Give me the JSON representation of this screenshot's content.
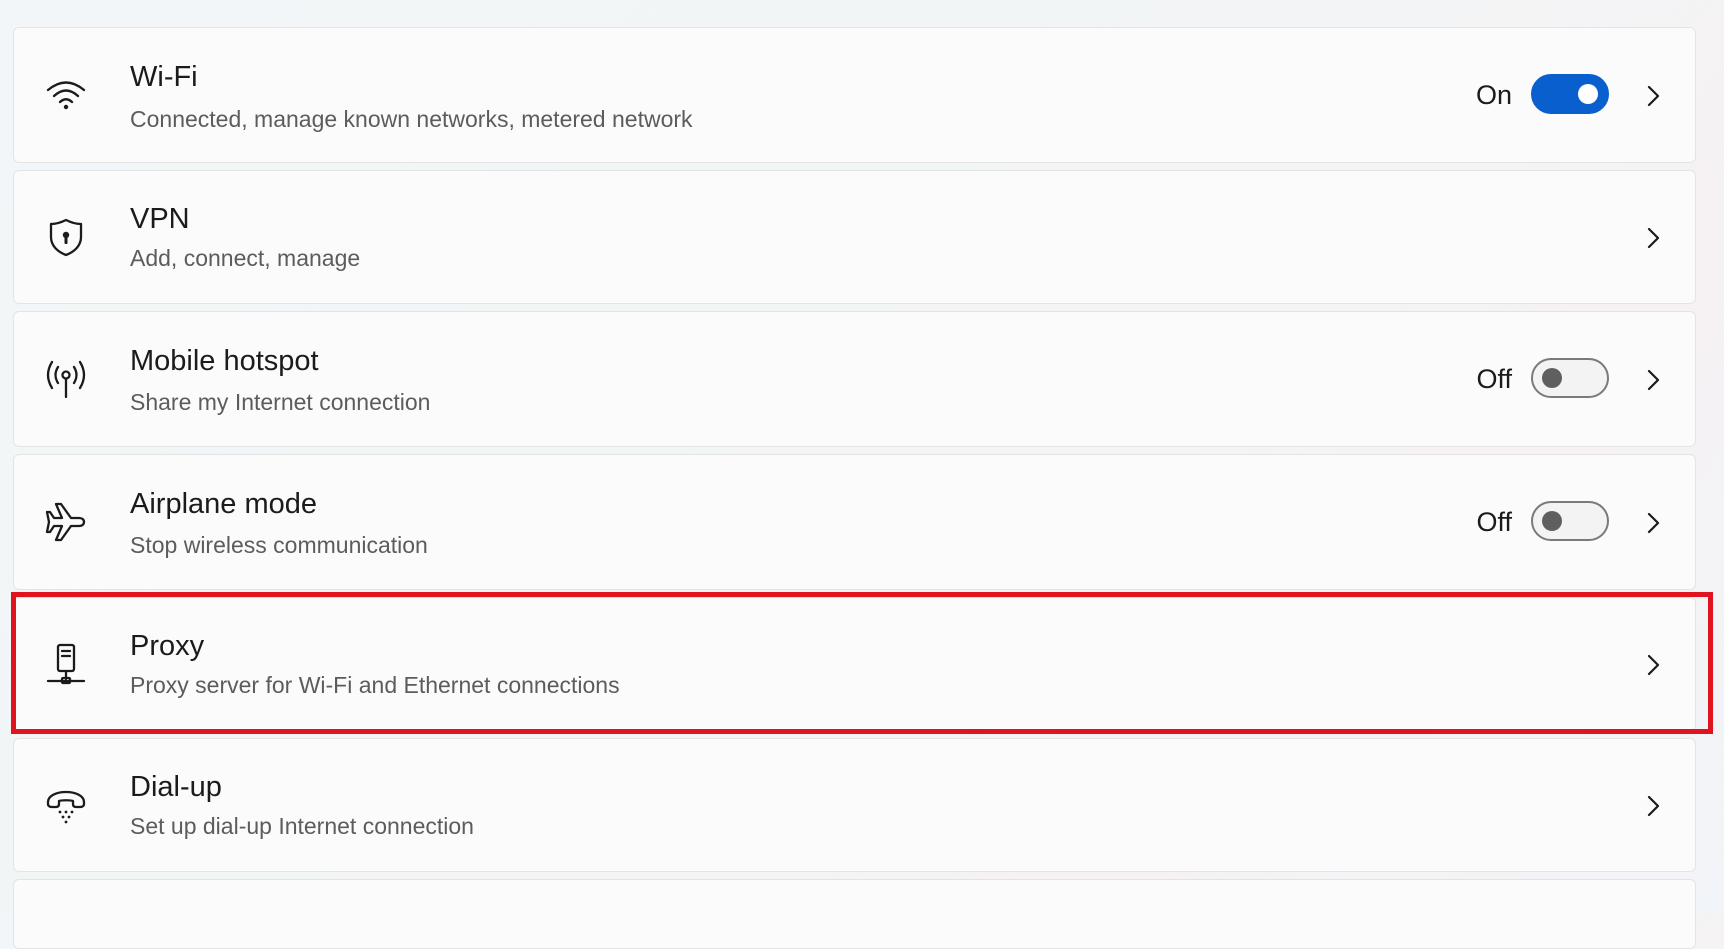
{
  "highlight_color": "#e0141e",
  "accent_color": "#0a5fcf",
  "items": [
    {
      "title": "Wi-Fi",
      "subtitle": "Connected, manage known networks, metered network",
      "state_label": "On",
      "toggle": "on",
      "icon": "wifi-icon"
    },
    {
      "title": "VPN",
      "subtitle": "Add, connect, manage",
      "icon": "vpn-shield-icon"
    },
    {
      "title": "Mobile hotspot",
      "subtitle": "Share my Internet connection",
      "state_label": "Off",
      "toggle": "off",
      "icon": "hotspot-icon"
    },
    {
      "title": "Airplane mode",
      "subtitle": "Stop wireless communication",
      "state_label": "Off",
      "toggle": "off",
      "icon": "airplane-icon"
    },
    {
      "title": "Proxy",
      "subtitle": "Proxy server for Wi-Fi and Ethernet connections",
      "icon": "proxy-icon",
      "highlighted": true
    },
    {
      "title": "Dial-up",
      "subtitle": "Set up dial-up Internet connection",
      "icon": "dialup-phone-icon"
    }
  ]
}
